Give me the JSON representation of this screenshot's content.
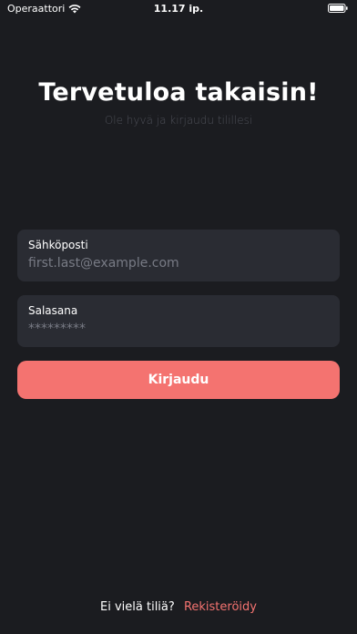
{
  "status_bar": {
    "carrier": "Operaattori",
    "time": "11.17 ip."
  },
  "header": {
    "title": "Tervetuloa takaisin!",
    "subtitle": "Ole hyvä ja kirjaudu tilillesi"
  },
  "form": {
    "email": {
      "label": "Sähköposti",
      "placeholder": "first.last@example.com",
      "value": ""
    },
    "password": {
      "label": "Salasana",
      "placeholder": "*********",
      "value": ""
    },
    "submit_label": "Kirjaudu"
  },
  "footer": {
    "prompt": "Ei vielä tiliä?",
    "register_label": "Rekisteröidy"
  },
  "colors": {
    "background": "#1b1c20",
    "field_background": "#2a2c33",
    "accent": "#f47370"
  },
  "icons": [
    "wifi-icon",
    "battery-icon"
  ]
}
